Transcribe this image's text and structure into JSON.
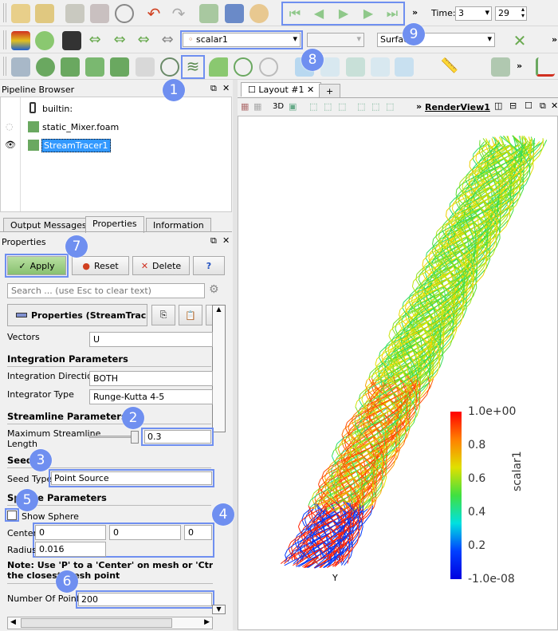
{
  "toolbar": {
    "time_label": "Time:",
    "time_value": "3",
    "time_index": "29",
    "array_select": "scalar1",
    "representation_select": "Surface",
    "more": "»"
  },
  "pipeline": {
    "title": "Pipeline Browser",
    "items": [
      "builtin:",
      "static_Mixer.foam",
      "StreamTracer1"
    ]
  },
  "tabs": [
    "Output Messages",
    "Properties",
    "Information"
  ],
  "properties": {
    "title": "Properties",
    "apply": "Apply",
    "reset": "Reset",
    "delete": "Delete",
    "help": "?",
    "search_placeholder": "Search ... (use Esc to clear text)",
    "section_header": "Properties (StreamTrac",
    "vectors_label": "Vectors",
    "vectors_value": "U",
    "integration_header": "Integration Parameters",
    "direction_label": "Integration Direction",
    "direction_value": "BOTH",
    "integrator_label": "Integrator Type",
    "integrator_value": "Runge-Kutta 4-5",
    "streamline_header": "Streamline Parameters",
    "max_length_label_1": "Maximum Streamline",
    "max_length_label_2": "Length",
    "max_length_value": "0.3",
    "seeds_header": "Seeds",
    "seed_type_label": "Seed Type",
    "seed_type_value": "Point Source",
    "sphere_header": "Sphere Parameters",
    "show_sphere": "Show Sphere",
    "show_sphere_checked": false,
    "center_label": "Center",
    "center": [
      "0",
      "0",
      "0"
    ],
    "radius_label": "Radius",
    "radius_value": "0.016",
    "note_1": "Note: Use 'P' to a 'Center' on mesh or 'Ctrl+P' t",
    "note_2": "the closest mesh point",
    "points_label": "Number Of Points",
    "points_value": "200"
  },
  "view": {
    "layout_tab": "Layout #1",
    "add_tab": "+",
    "threed": "3D",
    "render_view": "RenderView1",
    "more": "»",
    "colorbar": {
      "title": "scalar1",
      "labels": [
        "1.0e+00",
        "0.8",
        "0.6",
        "0.4",
        "0.2",
        "-1.0e-08"
      ]
    },
    "axis_label": "Y"
  },
  "annotations": [
    "1",
    "2",
    "3",
    "4",
    "5",
    "6",
    "7",
    "8",
    "9"
  ],
  "colors": {
    "highlight": "#6f8ff0",
    "selection": "#3399ff"
  }
}
